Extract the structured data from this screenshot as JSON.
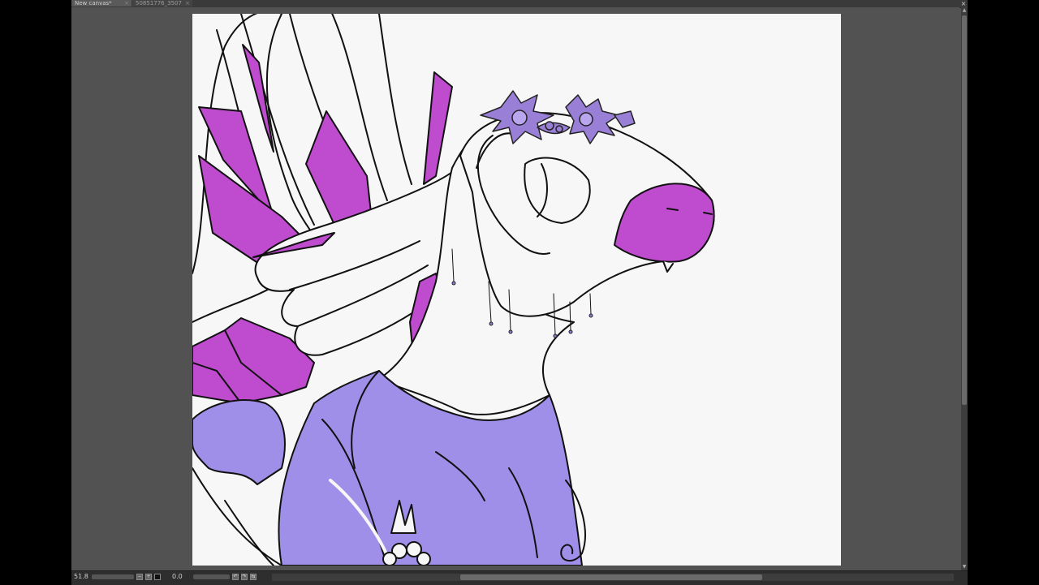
{
  "tabs": [
    {
      "label": "New canvas*",
      "active": true
    },
    {
      "label": "50851776_3507",
      "active": false
    }
  ],
  "tab_close_icon": "close-icon",
  "window_close_icon": "close-icon",
  "status": {
    "zoom": "51.8",
    "angle": "0.0",
    "zoom_out_icon": "minus-icon",
    "zoom_in_icon": "plus-icon",
    "reset_icon": "reset-icon",
    "rotate_left_icon": "rotate-left-icon",
    "rotate_right_icon": "rotate-right-icon",
    "flip_icon": "flip-icon"
  },
  "colors": {
    "magenta": "#bf4bce",
    "lavender": "#9f8fe8",
    "flower": "#9a7fd6",
    "paper": "#f7f7f7",
    "workspace": "#525252"
  }
}
